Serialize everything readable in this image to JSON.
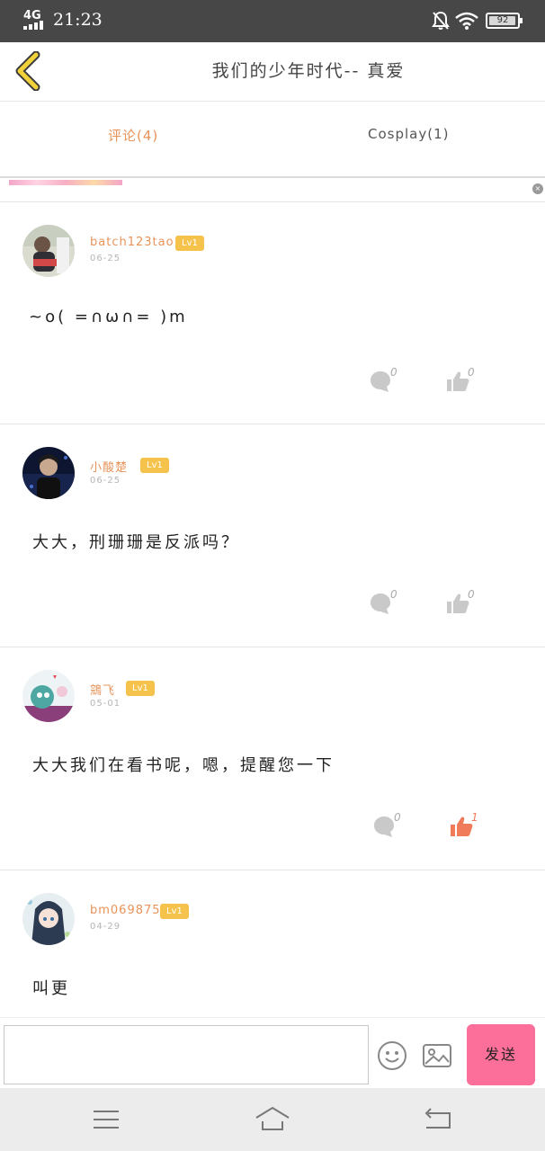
{
  "status_bar": {
    "network": "4G",
    "time": "21:23",
    "battery": "92"
  },
  "header": {
    "title": "我们的少年时代-- 真爱"
  },
  "tabs": [
    {
      "label": "评论(4)",
      "active": true
    },
    {
      "label": "Cosplay(1)",
      "active": false
    }
  ],
  "comments": [
    {
      "username": "batch123tao",
      "level": "Lv1",
      "date": "06-25",
      "content": "~o( =∩ω∩= )m",
      "reply_count": "0",
      "like_count": "0",
      "liked": false
    },
    {
      "username": "小酸楚",
      "level": "Lv1",
      "date": "06-25",
      "content": "大大，刑珊珊是反派吗？",
      "reply_count": "0",
      "like_count": "0",
      "liked": false
    },
    {
      "username": "鵍飞",
      "level": "Lv1",
      "date": "05-01",
      "content": "大大我们在看书呢，嗯，提醒您一下",
      "reply_count": "0",
      "like_count": "1",
      "liked": true
    },
    {
      "username": "bm06987517",
      "level": "Lv1",
      "date": "04-29",
      "content": "叫更",
      "reply_count": "",
      "like_count": "",
      "liked": false
    }
  ],
  "input_bar": {
    "placeholder": "",
    "send_label": "发送"
  },
  "colors": {
    "accent": "#e8935a",
    "badge": "#f5c24c",
    "send": "#fc6f9a",
    "liked": "#ef7b5a"
  }
}
